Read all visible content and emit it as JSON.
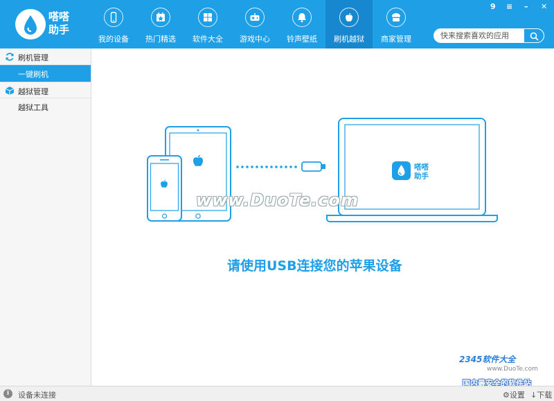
{
  "app": {
    "brand": "嗒嗒助手"
  },
  "nav": {
    "items": [
      {
        "label": "我的设备",
        "icon": "phone-icon"
      },
      {
        "label": "热门精选",
        "icon": "calendar-icon"
      },
      {
        "label": "软件大全",
        "icon": "apps-grid-icon"
      },
      {
        "label": "游戏中心",
        "icon": "gamepad-icon"
      },
      {
        "label": "铃声壁纸",
        "icon": "bell-icon"
      },
      {
        "label": "刷机越狱",
        "icon": "apple-icon"
      },
      {
        "label": "商家管理",
        "icon": "store-icon"
      }
    ],
    "active_index": 5
  },
  "window_controls": {
    "badge": "9",
    "menu": "≡",
    "minimize": "–",
    "close": "✕"
  },
  "search": {
    "placeholder": "快来搜索喜欢的应用"
  },
  "sidebar": {
    "group1": {
      "label": "刷机管理",
      "item": "一键刷机"
    },
    "group2": {
      "label": "越狱管理",
      "item": "越狱工具"
    }
  },
  "main": {
    "laptop_brand": "嗒嗒助手",
    "message": "请使用USB连接您的苹果设备",
    "watermark": "www.DuoTe.com"
  },
  "watermark2": {
    "brand": "2345软件大全",
    "url": "www.DuoTe.com",
    "slogan": "国内最安全的软件站"
  },
  "status": {
    "text": "设备未连接",
    "settings": "设置",
    "download": "下载"
  },
  "colors": {
    "accent": "#1e9fe6",
    "nav_active": "#1788cf"
  }
}
